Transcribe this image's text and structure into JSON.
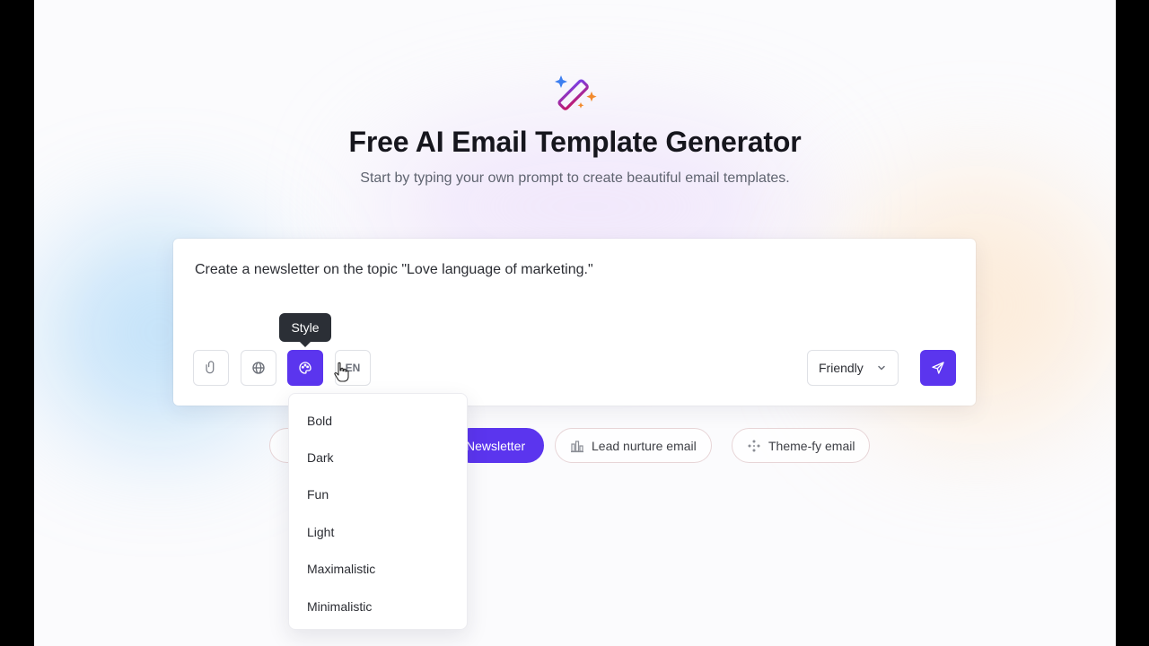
{
  "header": {
    "title": "Free AI Email Template Generator",
    "subtitle": "Start by typing your own prompt to create beautiful email templates."
  },
  "prompt": {
    "text": "Create a newsletter on the topic \"Love language of marketing.\""
  },
  "toolbar": {
    "attach_icon": "paperclip-icon",
    "web_icon": "globe-icon",
    "style_icon": "palette-icon",
    "language_label": "EN",
    "tooltip": "Style",
    "tone_value": "Friendly",
    "send_icon": "send-icon"
  },
  "chips": [
    {
      "label": "Newsletter",
      "active": true
    },
    {
      "label": "Lead nurture email",
      "icon": "building-chart-icon"
    },
    {
      "label": "Theme-fy email",
      "icon": "sparkle-dots-icon"
    }
  ],
  "style_menu": {
    "items": [
      "Bold",
      "Dark",
      "Fun",
      "Light",
      "Maximalistic",
      "Minimalistic"
    ]
  },
  "colors": {
    "accent": "#5b35ee",
    "tooltip_bg": "#2b2f36",
    "title": "#16161d"
  }
}
